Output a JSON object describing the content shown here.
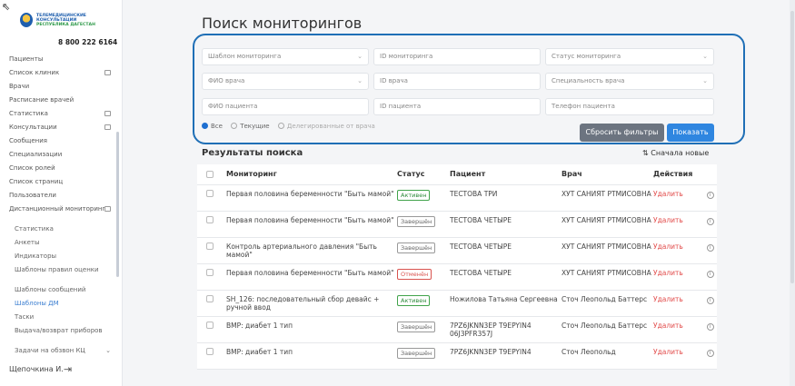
{
  "sidebar": {
    "logo_lines": [
      "ТЕЛЕМЕДИЦИНСКИЕ",
      "КОНСУЛЬТАЦИИ",
      "РЕСПУБЛИКА ДАГЕСТАН"
    ],
    "phone": "8 800 222 6164",
    "items": [
      {
        "label": "Пациенты"
      },
      {
        "label": "Список клиник"
      },
      {
        "label": "Врачи"
      },
      {
        "label": "Расписание врачей"
      },
      {
        "label": "Статистика"
      },
      {
        "label": "Консультации"
      },
      {
        "label": "Сообщения"
      },
      {
        "label": "Специализации"
      },
      {
        "label": "Список ролей"
      },
      {
        "label": "Список страниц"
      },
      {
        "label": "Пользователи"
      },
      {
        "label": "Дистанционный мониторинг"
      },
      {
        "label": "Статистика"
      },
      {
        "label": "Анкеты"
      },
      {
        "label": "Индикаторы"
      },
      {
        "label": "Шаблоны правил оценки"
      },
      {
        "label": "Шаблоны сообщений"
      },
      {
        "label": "Шаблоны ДМ"
      },
      {
        "label": "Таски"
      },
      {
        "label": "Выдача/возврат приборов"
      },
      {
        "label": "Задачи на обзвон КЦ"
      }
    ],
    "user": "Щепочкина И."
  },
  "page": {
    "title": "Поиск мониторингов"
  },
  "filters": {
    "template": "Шаблон мониторинга",
    "monitoring_id": "ID мониторинга",
    "status": "Статус мониторинга",
    "doctor_name": "ФИО врача",
    "doctor_id": "ID врача",
    "doctor_specialty": "Специальность врача",
    "patient_name": "ФИО пациента",
    "patient_id": "ID пациента",
    "patient_phone": "Телефон пациента",
    "radio": [
      "Все",
      "Текущие",
      "Делегированные от врача"
    ],
    "reset_label": "Сбросить фильтры",
    "show_label": "Показать"
  },
  "results": {
    "title": "Результаты поиска",
    "sort_label": "Сначала новые",
    "headers": [
      "Мониторинг",
      "Статус",
      "Пациент",
      "Врач",
      "Действия"
    ],
    "rows": [
      {
        "monitoring": "Первая половина беременности \"Быть мамой\"",
        "status": "Активен",
        "status_kind": "green",
        "patient": "ТЕСТОВА ТРИ",
        "doctor": "ХУТ САНИЯТ РТМИСОВНА",
        "action": "Удалить"
      },
      {
        "monitoring": "Первая половина беременности \"Быть мамой\"",
        "status": "Завершён",
        "status_kind": "gray",
        "patient": "ТЕСТОВА ЧЕТЫРЕ",
        "doctor": "ХУТ САНИЯТ РТМИСОВНА",
        "action": "Удалить"
      },
      {
        "monitoring": "Контроль артериального давления \"Быть мамой\"",
        "status": "Завершён",
        "status_kind": "gray",
        "patient": "ТЕСТОВА ЧЕТЫРЕ",
        "doctor": "ХУТ САНИЯТ РТМИСОВНА",
        "action": "Удалить"
      },
      {
        "monitoring": "Первая половина беременности \"Быть мамой\"",
        "status": "Отменён",
        "status_kind": "red",
        "patient": "ТЕСТОВА ЧЕТЫРЕ",
        "doctor": "ХУТ САНИЯТ РТМИСОВНА",
        "action": "Удалить"
      },
      {
        "monitoring": "SH_126: последовательный сбор девайс + ручной ввод",
        "status": "Активен",
        "status_kind": "green",
        "patient": "Ножилова Татьяна Сергеевна",
        "doctor": "Сточ Леопольд Баттерс",
        "action": "Удалить"
      },
      {
        "monitoring": "BMP: диабет 1 тип",
        "status": "Завершён",
        "status_kind": "gray",
        "patient": "7PZ6JKNN3EP T9EPYIN4 06J3PFR357J",
        "doctor": "Сточ Леопольд Баттерс",
        "action": "Удалить"
      },
      {
        "monitoring": "BMP: диабет 1 тип",
        "status": "Завершён",
        "status_kind": "gray",
        "patient": "7PZ6JKNN3EP T9EPYIN4",
        "doctor": "Сточ Леопольд",
        "action": "Удалить"
      }
    ]
  }
}
